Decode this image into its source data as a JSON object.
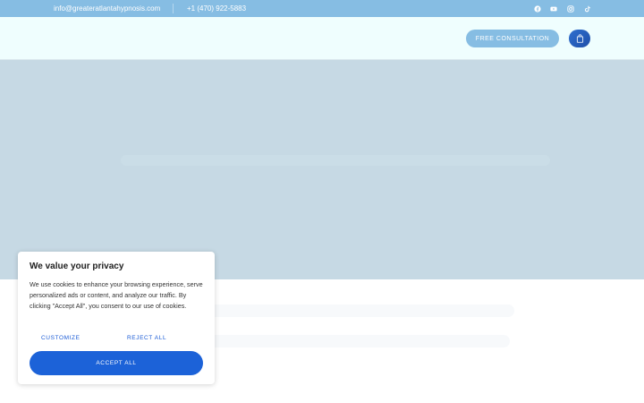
{
  "topbar": {
    "email": "info@greateratlantahypnosis.com",
    "phone": "+1 (470) 922-5883",
    "social_icons": [
      "facebook-icon",
      "youtube-icon",
      "instagram-icon",
      "tiktok-icon"
    ]
  },
  "header": {
    "consult_label": "FREE CONSULTATION",
    "cart_icon": "shopping-bag-icon"
  },
  "cookie_banner": {
    "title": "We value your privacy",
    "body": "We use cookies to enhance your browsing experience, serve personalized ads or content, and analyze our traffic. By clicking \"Accept All\", you consent to our use of cookies.",
    "customize_label": "CUSTOMIZE",
    "reject_label": "REJECT ALL",
    "accept_label": "ACCEPT ALL"
  },
  "colors": {
    "topbar_bg": "#86bde3",
    "header_bg": "#effefe",
    "hero_bg": "#c6d9e4",
    "accent_blue": "#1c62d8"
  }
}
